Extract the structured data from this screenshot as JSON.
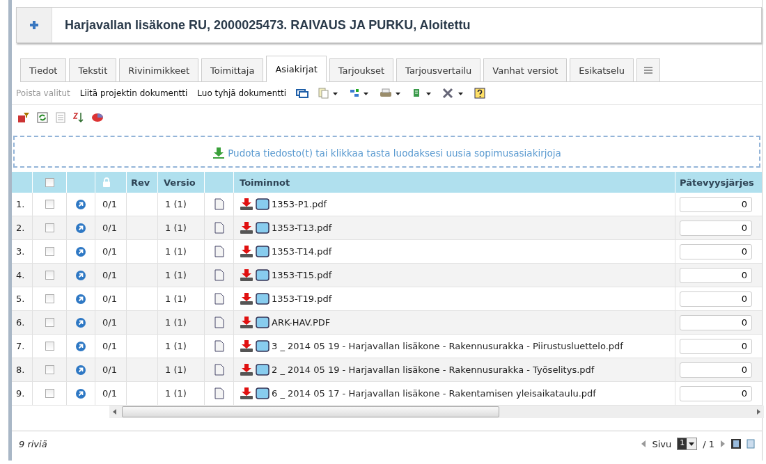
{
  "header": {
    "title": "Harjavallan lisäkone RU, 2000025473. RAIVAUS JA PURKU, Aloitettu"
  },
  "tabs": [
    {
      "label": "Tiedot",
      "selected": false
    },
    {
      "label": "Tekstit",
      "selected": false
    },
    {
      "label": "Rivinimikkeet",
      "selected": false
    },
    {
      "label": "Toimittaja",
      "selected": false
    },
    {
      "label": "Asiakirjat",
      "selected": true
    },
    {
      "label": "Tarjoukset",
      "selected": false
    },
    {
      "label": "Tarjousvertailu",
      "selected": false
    },
    {
      "label": "Vanhat versiot",
      "selected": false
    },
    {
      "label": "Esikatselu",
      "selected": false
    }
  ],
  "toolbar": [
    {
      "label": "Poista valitut",
      "disabled": true
    },
    {
      "label": "Liitä projektin dokumentti",
      "disabled": false
    },
    {
      "label": "Luo tyhjä dokumentti",
      "disabled": false
    }
  ],
  "dropzone": {
    "text": "Pudota tiedosto(t) tai klikkaa tasta luodaksesi uusia sopimusasiakirjoja"
  },
  "table": {
    "select_all_checked": false,
    "columns": [
      "Rev",
      "Versio",
      "Toiminnot",
      "Pätevyysjärjes"
    ],
    "rows": [
      {
        "num": "1.",
        "checked": false,
        "count": "0/1",
        "version": "1 (1)",
        "file": "1353-P1.pdf",
        "order": "0"
      },
      {
        "num": "2.",
        "checked": false,
        "count": "0/1",
        "version": "1 (1)",
        "file": "1353-T13.pdf",
        "order": "0"
      },
      {
        "num": "3.",
        "checked": false,
        "count": "0/1",
        "version": "1 (1)",
        "file": "1353-T14.pdf",
        "order": "0"
      },
      {
        "num": "4.",
        "checked": false,
        "count": "0/1",
        "version": "1 (1)",
        "file": "1353-T15.pdf",
        "order": "0"
      },
      {
        "num": "5.",
        "checked": false,
        "count": "0/1",
        "version": "1 (1)",
        "file": "1353-T19.pdf",
        "order": "0"
      },
      {
        "num": "6.",
        "checked": false,
        "count": "0/1",
        "version": "1 (1)",
        "file": "ARK-HAV.PDF",
        "order": "0"
      },
      {
        "num": "7.",
        "checked": false,
        "count": "0/1",
        "version": "1 (1)",
        "file": "3 _ 2014 05 19 - Harjavallan lisäkone - Rakennusurakka - Piirustusluettelo.pdf",
        "order": "0"
      },
      {
        "num": "8.",
        "checked": false,
        "count": "0/1",
        "version": "1 (1)",
        "file": "2 _ 2014 05 19 - Harjavallan lisäkone - Rakennusurakka - Työselitys.pdf",
        "order": "0"
      },
      {
        "num": "9.",
        "checked": false,
        "count": "0/1",
        "version": "1 (1)",
        "file": "6 _ 2014 05 17 - Harjavallan lisäkone - Rakentamisen yleisaikataulu.pdf",
        "order": "0"
      }
    ]
  },
  "footer": {
    "rows": "9 riviä",
    "page_label": "Sivu",
    "page": "1",
    "total": "/ 1"
  }
}
